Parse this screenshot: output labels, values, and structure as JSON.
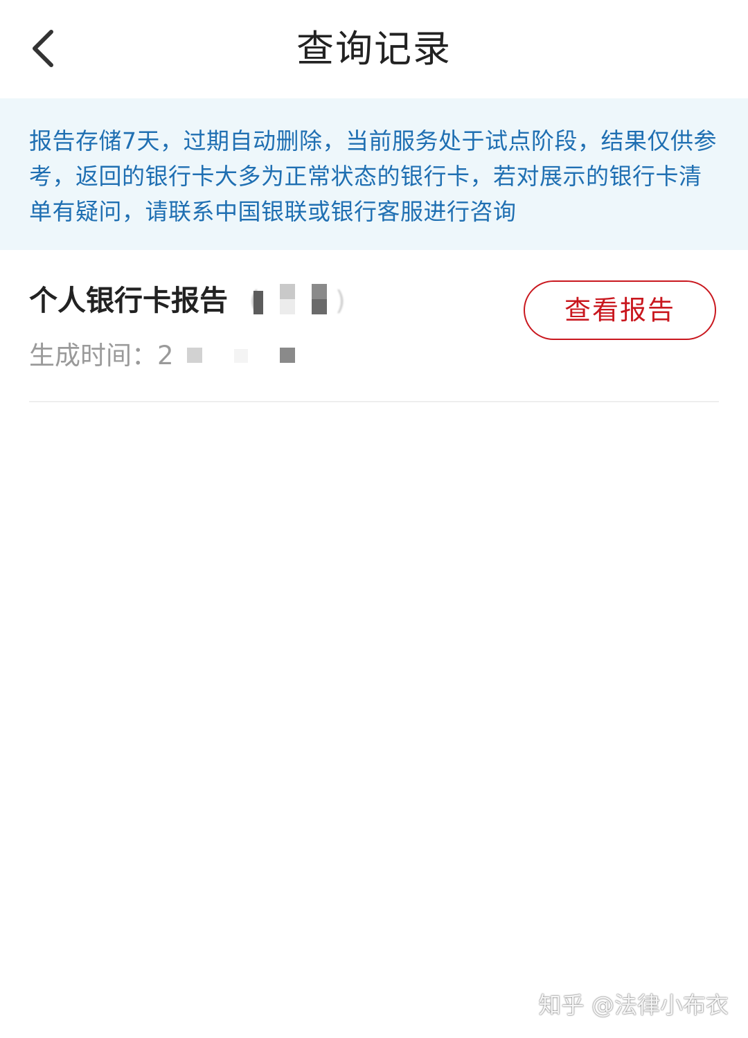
{
  "header": {
    "back_icon": "chevron-left-icon",
    "title": "查询记录"
  },
  "notice": {
    "text": "报告存储7天，过期自动删除，当前服务处于试点阶段，结果仅供参考，返回的银行卡大多为正常状态的银行卡，若对展示的银行卡清单有疑问，请联系中国银联或银行客服进行咨询"
  },
  "report": {
    "title": "个人银行卡报告",
    "title_suffix_visible": "(",
    "title_suffix_end": ")",
    "time_label": "生成时间：",
    "time_value_visible": "2",
    "view_button": "查看报告"
  },
  "watermark": {
    "text": "知乎 @法律小布衣"
  },
  "colors": {
    "accent_red": "#c9171e",
    "notice_bg": "#eef7fb",
    "notice_text": "#1f6fb2",
    "secondary_text": "#9a9a9a"
  }
}
